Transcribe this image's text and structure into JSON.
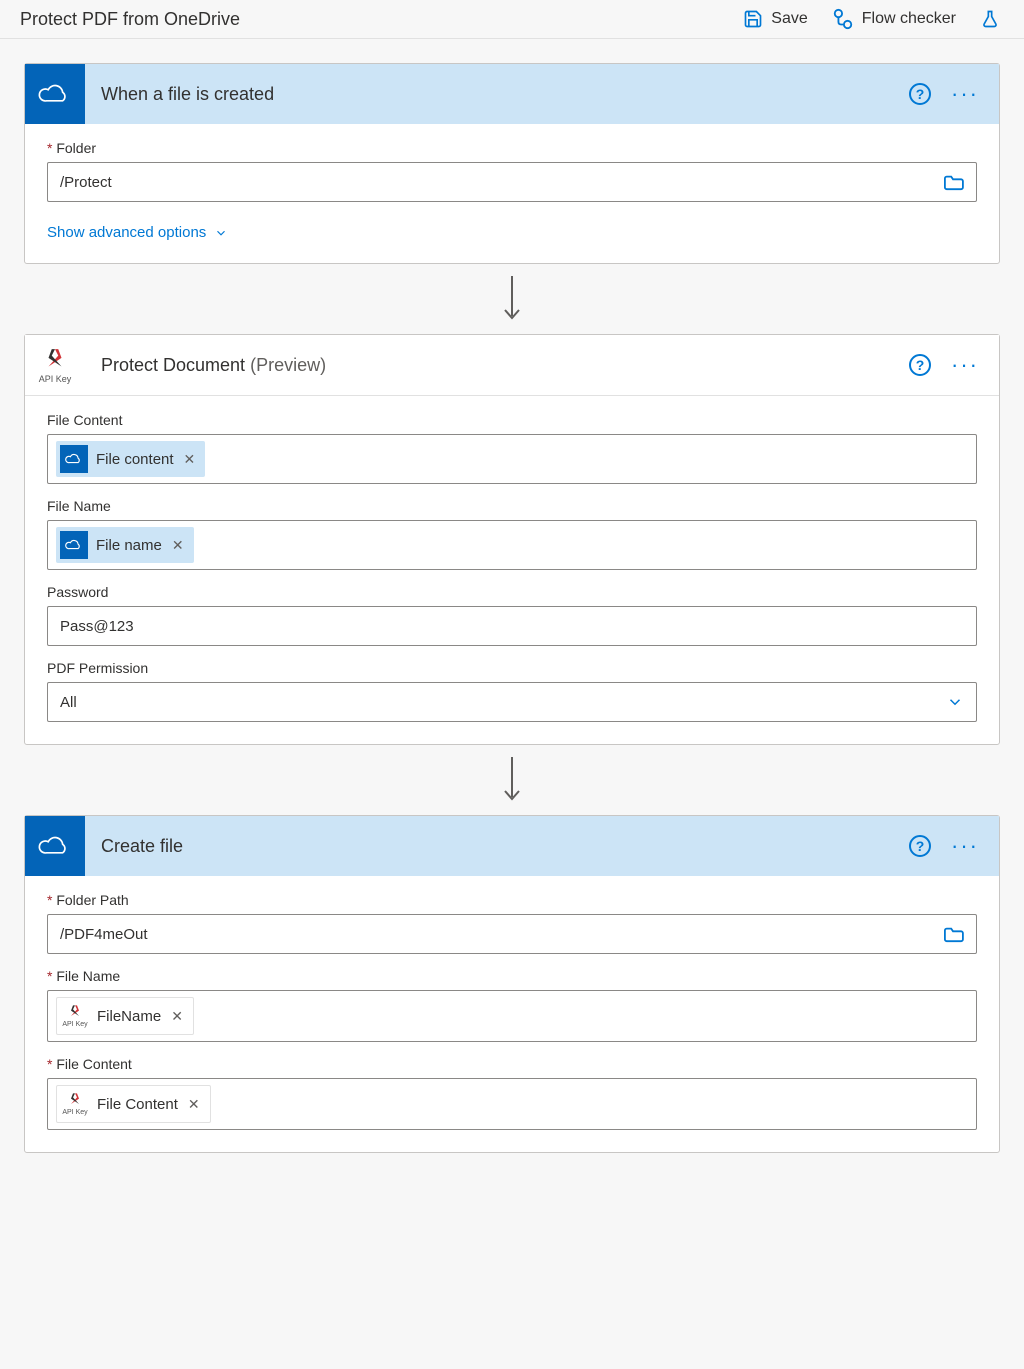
{
  "topbar": {
    "title": "Protect PDF from OneDrive",
    "save": "Save",
    "flowchecker": "Flow checker"
  },
  "step1": {
    "title": "When a file is created",
    "folder_label": "Folder",
    "folder_value": "/Protect",
    "show_advanced": "Show advanced options"
  },
  "step2": {
    "title": "Protect Document",
    "preview": "(Preview)",
    "api_label": "API Key",
    "file_content_label": "File Content",
    "file_content_token": "File content",
    "file_name_label": "File Name",
    "file_name_token": "File name",
    "password_label": "Password",
    "password_value": "Pass@123",
    "pdf_permission_label": "PDF Permission",
    "pdf_permission_value": "All"
  },
  "step3": {
    "title": "Create file",
    "folder_path_label": "Folder Path",
    "folder_path_value": "/PDF4meOut",
    "file_name_label": "File Name",
    "file_name_token": "FileName",
    "file_content_label": "File Content",
    "file_content_token": "File Content",
    "api_label": "API Key"
  }
}
